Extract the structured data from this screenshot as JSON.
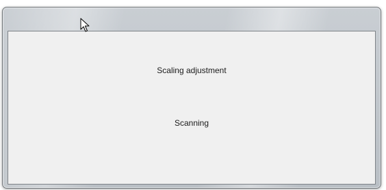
{
  "dialog": {
    "title": "",
    "status_primary": "Scaling adjustment",
    "status_secondary": "Scanning"
  },
  "cursor": {
    "icon": "arrow-pointer-icon"
  },
  "colors": {
    "client_background": "#f0f0f0",
    "frame": "#c0c5ca",
    "text": "#1a1a1a"
  }
}
